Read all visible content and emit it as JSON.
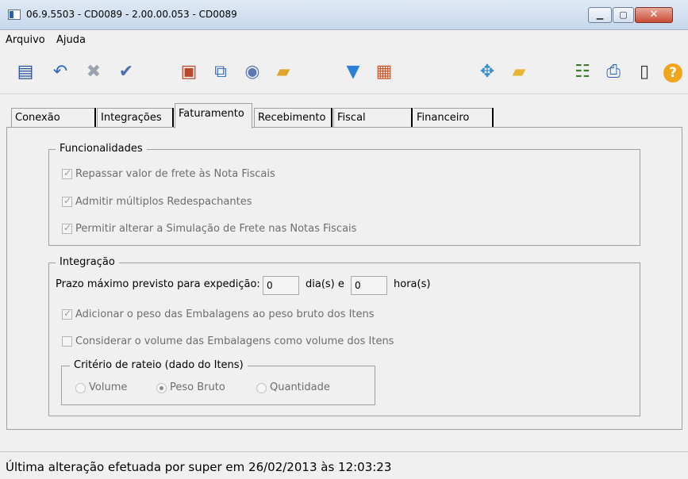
{
  "window": {
    "title": "06.9.5503 - CD0089 - 2.00.00.053 - CD0089",
    "minimize_glyph": "▁",
    "maximize_glyph": "▢",
    "close_glyph": "✕"
  },
  "menubar": {
    "items": [
      "Arquivo",
      "Ajuda"
    ]
  },
  "toolbar": {
    "icons": [
      {
        "name": "edit-doc-icon",
        "glyph": "▤",
        "color": "#1f4f9a"
      },
      {
        "name": "undo-icon",
        "glyph": "↶",
        "color": "#2d6bc1"
      },
      {
        "name": "cancel-icon",
        "glyph": "✖",
        "color": "#9aa3b0"
      },
      {
        "name": "confirm-icon",
        "glyph": "✔",
        "color": "#4a6fb3"
      },
      {
        "name": "clipboard-check-icon",
        "glyph": "▣",
        "color": "#b9472b"
      },
      {
        "name": "copy-icon",
        "glyph": "⧉",
        "color": "#3d72c8"
      },
      {
        "name": "process-icon",
        "glyph": "◉",
        "color": "#5a79b4"
      },
      {
        "name": "folder-delete-icon",
        "glyph": "▰",
        "color": "#e0a42b"
      },
      {
        "name": "filter-icon",
        "glyph": "▼",
        "color": "#2b7fd6"
      },
      {
        "name": "calendar-icon",
        "glyph": "▦",
        "color": "#c9582c"
      },
      {
        "name": "move-arrows-icon",
        "glyph": "✥",
        "color": "#3b8ed0"
      },
      {
        "name": "new-folder-icon",
        "glyph": "▰",
        "color": "#e8b530"
      },
      {
        "name": "tree-icon",
        "glyph": "☷",
        "color": "#3e7a2f"
      },
      {
        "name": "print-icon",
        "glyph": "⎙",
        "color": "#2563b6"
      },
      {
        "name": "exit-door-icon",
        "glyph": "▯",
        "color": "#333333"
      },
      {
        "name": "help-icon",
        "glyph": "?",
        "color": "#f1a51a"
      }
    ]
  },
  "tabs": [
    "Conexão",
    "Integrações",
    "Faturamento",
    "Recebimento",
    "Fiscal",
    "Financeiro"
  ],
  "funcionalidades": {
    "legend": "Funcionalidades",
    "options": [
      {
        "label": "Repassar valor de frete às Nota Fiscais",
        "checked": true
      },
      {
        "label": "Admitir múltiplos Redespachantes",
        "checked": true
      },
      {
        "label": "Permitir alterar a Simulação de Frete nas Notas Fiscais",
        "checked": true
      }
    ]
  },
  "integracao": {
    "legend": "Integração",
    "prazo_label": "Prazo máximo previsto para expedição:",
    "dias_value": "0",
    "dias_unit": "dia(s) e",
    "horas_value": "0",
    "horas_unit": "hora(s)",
    "options": [
      {
        "label": "Adicionar o peso das Embalagens ao peso bruto dos Itens",
        "checked": true
      },
      {
        "label": "Considerar o volume das Embalagens como volume dos Itens",
        "checked": false
      }
    ],
    "rateio": {
      "legend": "Critério de rateio (dado do Itens)",
      "options": [
        {
          "label": "Volume",
          "selected": false
        },
        {
          "label": "Peso Bruto",
          "selected": true
        },
        {
          "label": "Quantidade",
          "selected": false
        }
      ]
    }
  },
  "status": {
    "text": "Última alteração efetuada por super em 26/02/2013 às 12:03:23"
  }
}
